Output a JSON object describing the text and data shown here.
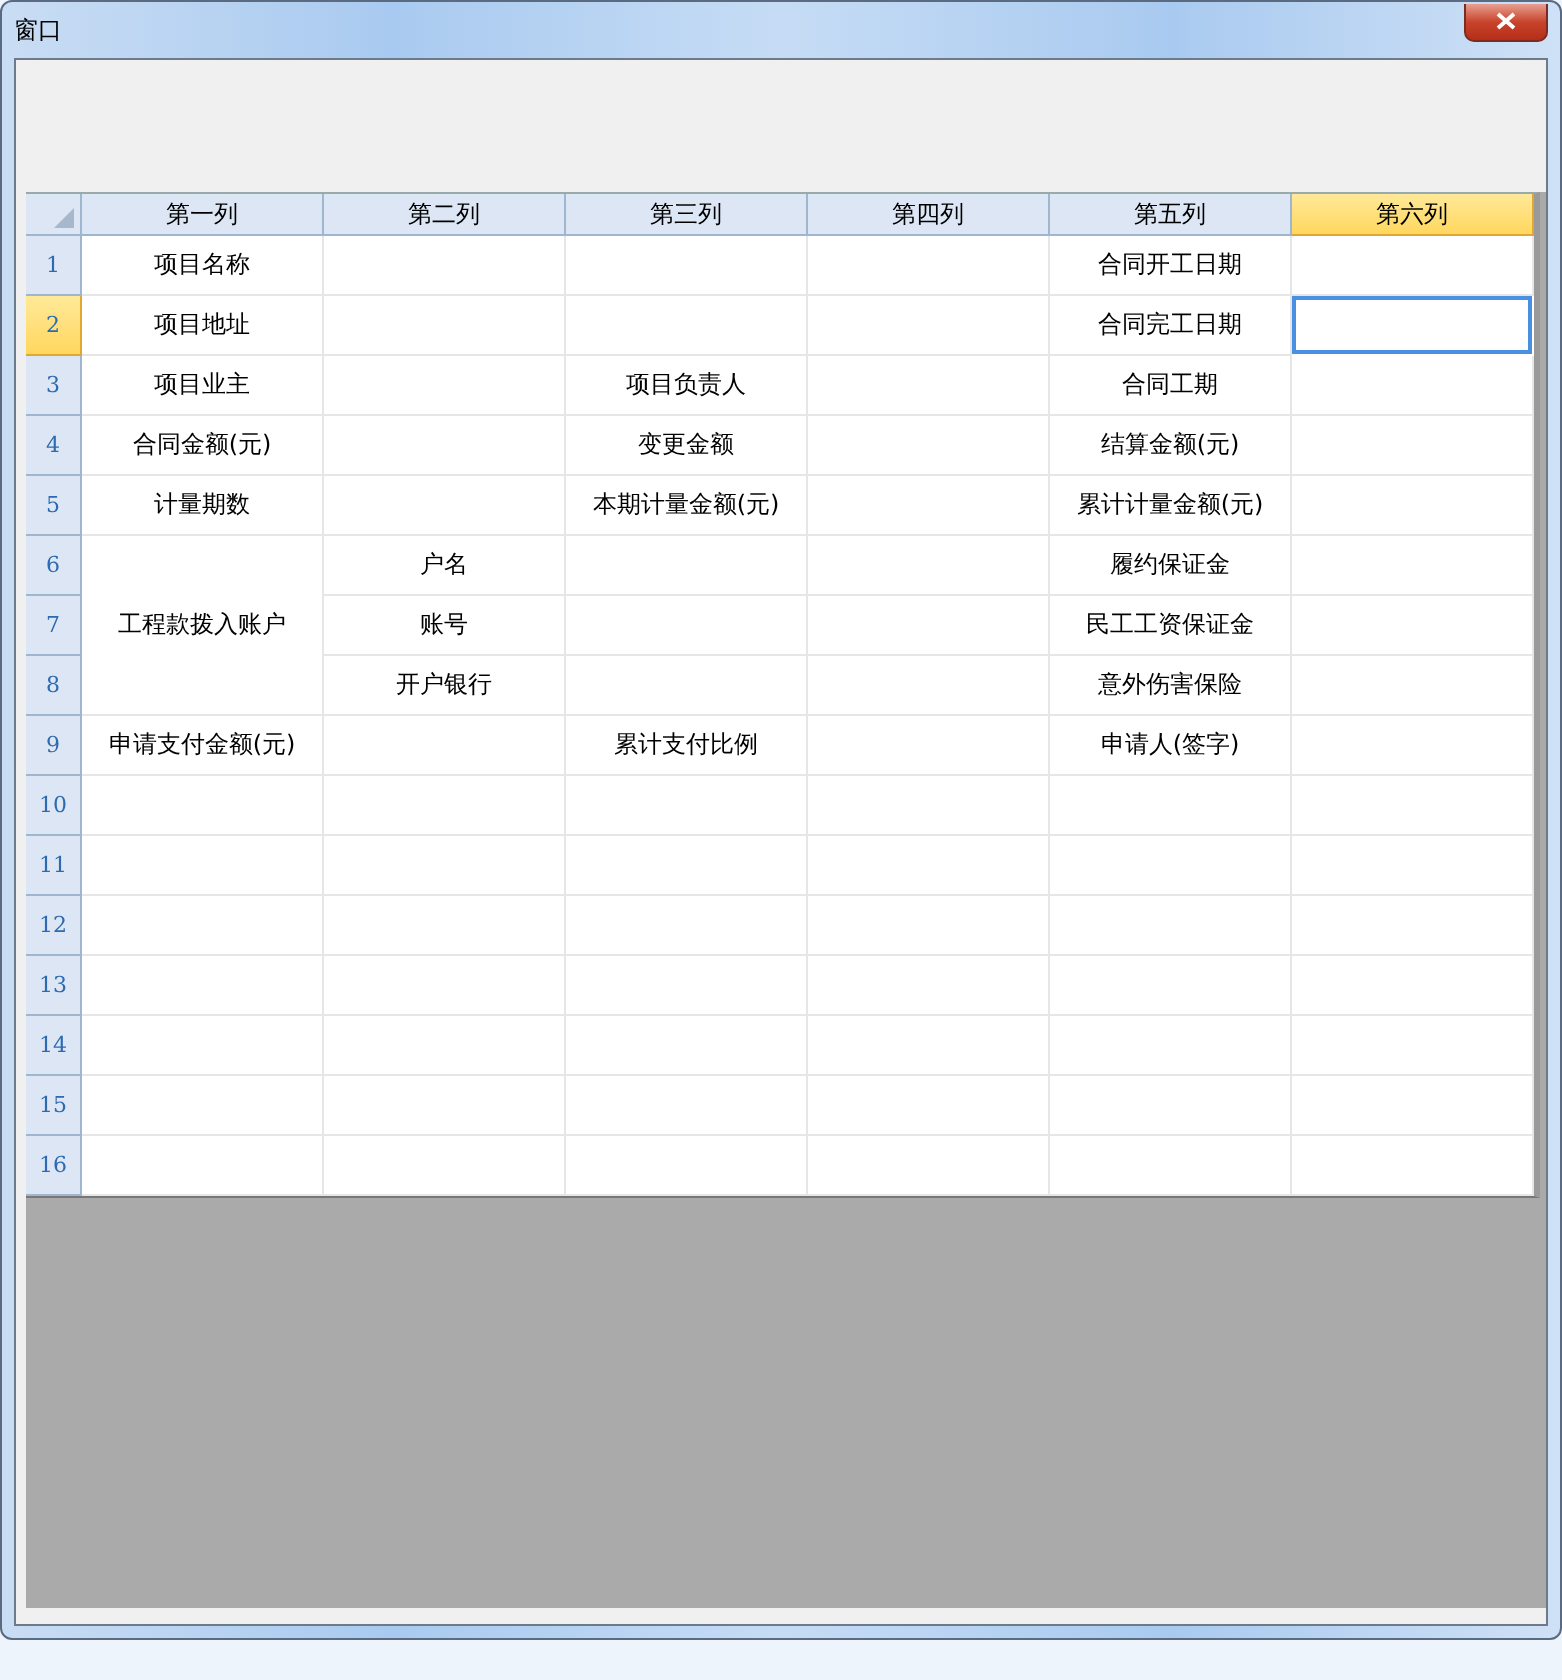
{
  "window": {
    "title": "窗口"
  },
  "grid": {
    "columns": [
      {
        "label": "第一列",
        "selected": false
      },
      {
        "label": "第二列",
        "selected": false
      },
      {
        "label": "第三列",
        "selected": false
      },
      {
        "label": "第四列",
        "selected": false
      },
      {
        "label": "第五列",
        "selected": false
      },
      {
        "label": "第六列",
        "selected": true
      }
    ],
    "rows": [
      {
        "label": "1",
        "selected": false,
        "cells": [
          {
            "text": "项目名称",
            "selected": false
          },
          {
            "selected": false
          },
          {
            "selected": false
          },
          {
            "selected": false
          },
          {
            "text": "合同开工日期",
            "selected": false
          },
          {
            "selected": false
          }
        ]
      },
      {
        "label": "2",
        "selected": true,
        "cells": [
          {
            "text": "项目地址",
            "selected": false
          },
          {
            "selected": false
          },
          {
            "selected": false
          },
          {
            "selected": false
          },
          {
            "text": "合同完工日期",
            "selected": false
          },
          {
            "selected": true
          }
        ]
      },
      {
        "label": "3",
        "selected": false,
        "cells": [
          {
            "text": "项目业主",
            "selected": false
          },
          {
            "selected": false
          },
          {
            "text": "项目负责人",
            "selected": false
          },
          {
            "selected": false
          },
          {
            "text": "合同工期",
            "selected": false
          },
          {
            "selected": false
          }
        ]
      },
      {
        "label": "4",
        "selected": false,
        "cells": [
          {
            "text": "合同金额(元)",
            "selected": false
          },
          {
            "selected": false
          },
          {
            "text": "变更金额",
            "selected": false
          },
          {
            "selected": false
          },
          {
            "text": "结算金额(元)",
            "selected": false
          },
          {
            "selected": false
          }
        ]
      },
      {
        "label": "5",
        "selected": false,
        "cells": [
          {
            "text": "计量期数",
            "selected": false
          },
          {
            "selected": false
          },
          {
            "text": "本期计量金额(元)",
            "selected": false
          },
          {
            "selected": false
          },
          {
            "text": "累计计量金额(元)",
            "selected": false
          },
          {
            "selected": false
          }
        ]
      },
      {
        "label": "6",
        "selected": false,
        "cells": [
          {
            "kind": "merge-start",
            "selected": false
          },
          {
            "text": "户名",
            "selected": false
          },
          {
            "selected": false
          },
          {
            "selected": false
          },
          {
            "text": "履约保证金",
            "selected": false
          },
          {
            "selected": false
          }
        ]
      },
      {
        "label": "7",
        "selected": false,
        "cells": [
          {
            "kind": "merge-continue",
            "text": "工程款拨入账户"
          },
          {
            "text": "账号",
            "selected": false
          },
          {
            "selected": false
          },
          {
            "selected": false
          },
          {
            "text": "民工工资保证金",
            "selected": false
          },
          {
            "selected": false
          }
        ]
      },
      {
        "label": "8",
        "selected": false,
        "cells": [
          {
            "kind": "merge-continue"
          },
          {
            "text": "开户银行",
            "selected": false
          },
          {
            "selected": false
          },
          {
            "selected": false
          },
          {
            "text": "意外伤害保险",
            "selected": false
          },
          {
            "selected": false
          }
        ]
      },
      {
        "label": "9",
        "selected": false,
        "cells": [
          {
            "text": "申请支付金额(元)",
            "selected": false
          },
          {
            "selected": false
          },
          {
            "text": "累计支付比例",
            "selected": false
          },
          {
            "selected": false
          },
          {
            "text": "申请人(签字)",
            "selected": false
          },
          {
            "selected": false
          }
        ]
      },
      {
        "label": "10",
        "selected": false,
        "cells": [
          {
            "selected": false
          },
          {
            "selected": false
          },
          {
            "selected": false
          },
          {
            "selected": false
          },
          {
            "selected": false
          },
          {
            "selected": false
          }
        ]
      },
      {
        "label": "11",
        "selected": false,
        "cells": [
          {
            "selected": false
          },
          {
            "selected": false
          },
          {
            "selected": false
          },
          {
            "selected": false
          },
          {
            "selected": false
          },
          {
            "selected": false
          }
        ]
      },
      {
        "label": "12",
        "selected": false,
        "cells": [
          {
            "selected": false
          },
          {
            "selected": false
          },
          {
            "selected": false
          },
          {
            "selected": false
          },
          {
            "selected": false
          },
          {
            "selected": false
          }
        ]
      },
      {
        "label": "13",
        "selected": false,
        "cells": [
          {
            "selected": false
          },
          {
            "selected": false
          },
          {
            "selected": false
          },
          {
            "selected": false
          },
          {
            "selected": false
          },
          {
            "selected": false
          }
        ]
      },
      {
        "label": "14",
        "selected": false,
        "cells": [
          {
            "selected": false
          },
          {
            "selected": false
          },
          {
            "selected": false
          },
          {
            "selected": false
          },
          {
            "selected": false
          },
          {
            "selected": false
          }
        ]
      },
      {
        "label": "15",
        "selected": false,
        "cells": [
          {
            "selected": false
          },
          {
            "selected": false
          },
          {
            "selected": false
          },
          {
            "selected": false
          },
          {
            "selected": false
          },
          {
            "selected": false
          }
        ]
      },
      {
        "label": "16",
        "selected": false,
        "cells": [
          {
            "selected": false
          },
          {
            "selected": false
          },
          {
            "selected": false
          },
          {
            "selected": false
          },
          {
            "selected": false
          },
          {
            "selected": false
          }
        ]
      }
    ]
  }
}
